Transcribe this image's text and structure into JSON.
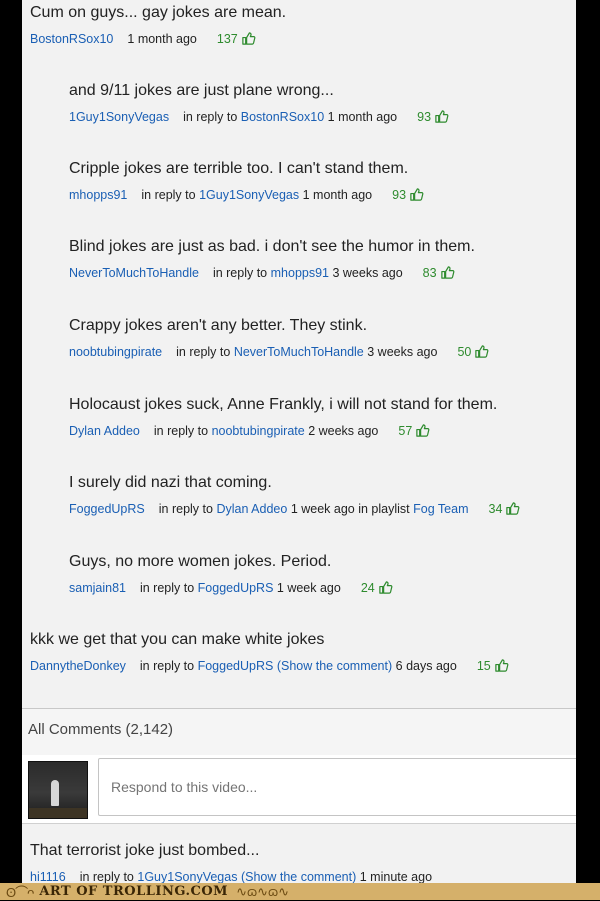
{
  "comments": [
    {
      "text": "Cum on guys... gay jokes are mean.",
      "user": "BostonRSox10",
      "reply_prefix": "",
      "reply_to": "",
      "show_comment": "",
      "time": "1 month ago",
      "extra_prefix": "",
      "extra_link": "",
      "likes": "137"
    },
    {
      "text": "and 9/11 jokes are just plane wrong...",
      "user": "1Guy1SonyVegas",
      "reply_prefix": "in reply to",
      "reply_to": "BostonRSox10",
      "show_comment": "",
      "time": "1 month ago",
      "extra_prefix": "",
      "extra_link": "",
      "likes": "93"
    },
    {
      "text": "Cripple jokes are terrible too. I can't stand them.",
      "user": "mhopps91",
      "reply_prefix": "in reply to",
      "reply_to": "1Guy1SonyVegas",
      "show_comment": "",
      "time": "1 month ago",
      "extra_prefix": "",
      "extra_link": "",
      "likes": "93"
    },
    {
      "text": "Blind jokes are just as bad. i don't see the humor in them.",
      "user": "NeverToMuchToHandle",
      "reply_prefix": "in reply to",
      "reply_to": "mhopps91",
      "show_comment": "",
      "time": "3 weeks ago",
      "extra_prefix": "",
      "extra_link": "",
      "likes": "83"
    },
    {
      "text": "Crappy jokes aren't any better. They stink.",
      "user": "noobtubingpirate",
      "reply_prefix": "in reply to",
      "reply_to": "NeverToMuchToHandle",
      "show_comment": "",
      "time": "3 weeks ago",
      "extra_prefix": "",
      "extra_link": "",
      "likes": "50"
    },
    {
      "text": "Holocaust jokes suck, Anne Frankly, i will not stand for them.",
      "user": "Dylan Addeo",
      "reply_prefix": "in reply to",
      "reply_to": "noobtubingpirate",
      "show_comment": "",
      "time": "2 weeks ago",
      "extra_prefix": "",
      "extra_link": "",
      "likes": "57"
    },
    {
      "text": "I surely did nazi that coming.",
      "user": "FoggedUpRS",
      "reply_prefix": "in reply to",
      "reply_to": "Dylan Addeo",
      "show_comment": "",
      "time": "1 week ago",
      "extra_prefix": "in playlist",
      "extra_link": "Fog Team",
      "likes": "34"
    },
    {
      "text": "Guys, no more women jokes. Period.",
      "user": "samjain81",
      "reply_prefix": "in reply to",
      "reply_to": "FoggedUpRS",
      "show_comment": "",
      "time": "1 week ago",
      "extra_prefix": "",
      "extra_link": "",
      "likes": "24"
    },
    {
      "text": "kkk we get that you can make white jokes",
      "user": "DannytheDonkey",
      "reply_prefix": "in reply to",
      "reply_to": "FoggedUpRS",
      "show_comment": "(Show the comment)",
      "time": "6 days ago",
      "extra_prefix": "",
      "extra_link": "",
      "likes": "15"
    }
  ],
  "all_comments_label": "All Comments (2,142)",
  "respond_placeholder": "Respond to this video...",
  "latest": {
    "text": "That terrorist joke just bombed...",
    "user": "hi1116",
    "reply_prefix": "in reply to",
    "reply_to": "1Guy1SonyVegas",
    "show_comment": "(Show the comment)",
    "time": "1 minute ago"
  },
  "watermark": "ART OF TROLLING.COM",
  "colors": {
    "link": "#1a5fb4",
    "likes": "#2e8b2e",
    "watermark_bg": "#d5b06a"
  },
  "icons": {
    "like": "thumbs-up-icon"
  }
}
